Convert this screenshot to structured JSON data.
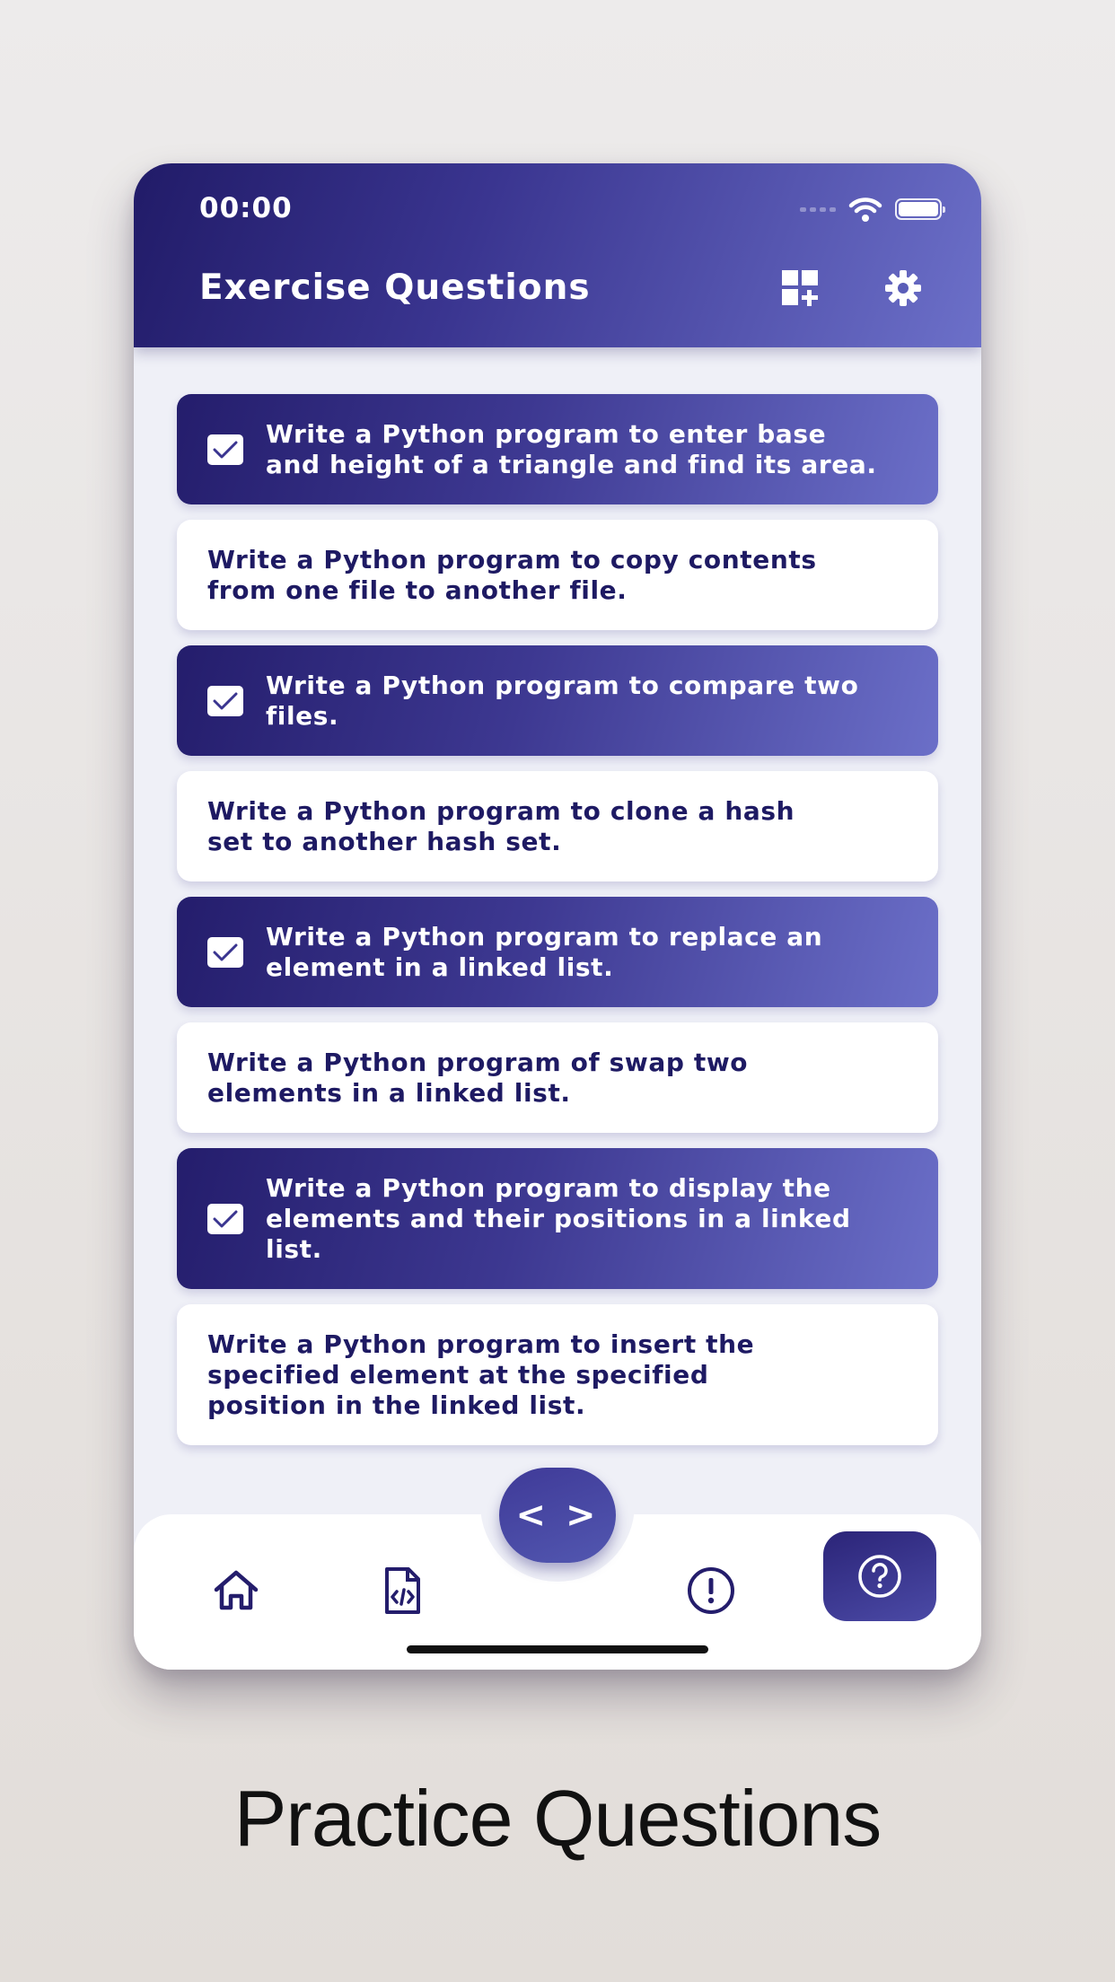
{
  "status_bar": {
    "time": "00:00",
    "icons": [
      "signal-icon",
      "wifi-icon",
      "battery-icon"
    ]
  },
  "header": {
    "title": "Exercise Questions",
    "actions": [
      "add-widget-icon",
      "settings-gear-icon"
    ]
  },
  "questions": [
    {
      "text": "Write a Python  program to enter base\nand height of a triangle and find its area.",
      "checked": true
    },
    {
      "text": "Write a Python  program to copy contents\nfrom one file to another file.",
      "checked": false
    },
    {
      "text": "Write a Python program to compare two\nfiles.",
      "checked": true
    },
    {
      "text": "Write a Python program to clone a hash\nset to another hash set.",
      "checked": false
    },
    {
      "text": "Write a Python program to replace an\nelement in a linked list.",
      "checked": true
    },
    {
      "text": "Write a Python program of swap two\nelements in a linked list.",
      "checked": false
    },
    {
      "text": "Write a Python program to display the\nelements and their positions in a linked\nlist.",
      "checked": true
    },
    {
      "text": "Write a Python program to insert the\nspecified element at the specified\nposition in the linked list.",
      "checked": false
    }
  ],
  "bottom_nav": {
    "items": [
      "home-icon",
      "code-file-icon",
      "code-brackets-icon",
      "alert-icon",
      "help-icon"
    ],
    "fab_label": "< >",
    "active": "help-icon"
  },
  "caption": "Practice Questions",
  "colors": {
    "gradient_start": "#211b68",
    "gradient_end": "#6c70c9",
    "text_dark": "#1e1a63"
  }
}
